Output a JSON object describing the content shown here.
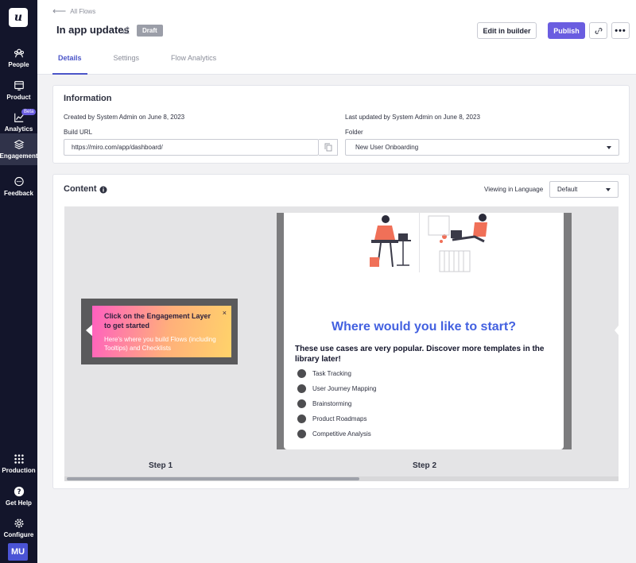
{
  "sidebar": {
    "logo": "u",
    "items": [
      {
        "label": "People",
        "icon": "people-icon"
      },
      {
        "label": "Product",
        "icon": "product-icon"
      },
      {
        "label": "Analytics",
        "icon": "analytics-icon",
        "badge": "Beta"
      },
      {
        "label": "Engagement",
        "icon": "layers-icon",
        "active": true
      },
      {
        "label": "Feedback",
        "icon": "chat-icon"
      }
    ],
    "bottom_items": [
      {
        "label": "Production",
        "icon": "grid-icon"
      },
      {
        "label": "Get Help",
        "icon": "help-icon"
      },
      {
        "label": "Configure",
        "icon": "gear-icon"
      }
    ],
    "avatar": "MU"
  },
  "header": {
    "back_label": "All Flows",
    "title": "In app updates",
    "status_badge": "Draft",
    "edit_in_builder": "Edit in builder",
    "publish": "Publish",
    "tabs": [
      {
        "label": "Details",
        "active": true
      },
      {
        "label": "Settings"
      },
      {
        "label": "Flow Analytics"
      }
    ]
  },
  "information": {
    "title": "Information",
    "created": "Created by System Admin on June 8, 2023",
    "updated": "Last updated by System Admin on June 8, 2023",
    "build_url_label": "Build URL",
    "build_url_value": "https://miro.com/app/dashboard/",
    "folder_label": "Folder",
    "folder_value": "New User Onboarding"
  },
  "content": {
    "title": "Content",
    "language_label": "Viewing in Language",
    "language_value": "Default",
    "steps": [
      {
        "label": "Step 1",
        "tooltip_title": "Click on the Engagement Layer to get started",
        "tooltip_body": "Here's where you build Flows (including Tooltips) and Checklists",
        "close": "×"
      },
      {
        "label": "Step 2",
        "heading": "Where would you like to start?",
        "subheading": "These use cases are very popular. Discover more templates in the library later!",
        "use_cases": [
          "Task Tracking",
          "User Journey Mapping",
          "Brainstorming",
          "Product Roadmaps",
          "Competitive Analysis"
        ]
      }
    ]
  },
  "colors": {
    "sidebar_bg": "#13152b",
    "accent": "#6a5de0",
    "heading_blue": "#4361e0"
  }
}
